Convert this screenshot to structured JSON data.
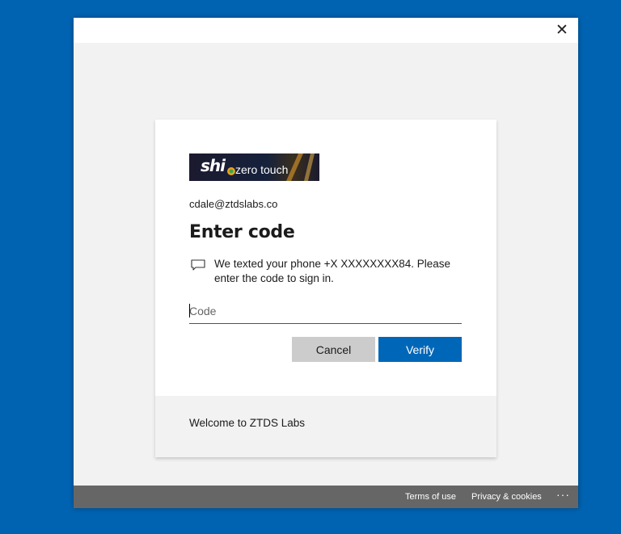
{
  "window": {
    "close_glyph": "✕"
  },
  "logo": {
    "brand": "shi",
    "tagline": "zero touch"
  },
  "signin": {
    "email": "cdale@ztdslabs.co",
    "title": "Enter code",
    "message_icon": "chat-bubble-icon",
    "message": "We texted your phone +X XXXXXXXX84. Please enter the code to sign in.",
    "code_placeholder": "Code",
    "code_value": "",
    "cancel_label": "Cancel",
    "verify_label": "Verify"
  },
  "footer": {
    "welcome": "Welcome to ZTDS Labs",
    "terms": "Terms of use",
    "privacy": "Privacy & cookies",
    "more": "···"
  },
  "colors": {
    "desktop_bg": "#0063b1",
    "accent": "#0067b8",
    "cancel_bg": "#cccccc",
    "bottom_bar": "#666666"
  }
}
